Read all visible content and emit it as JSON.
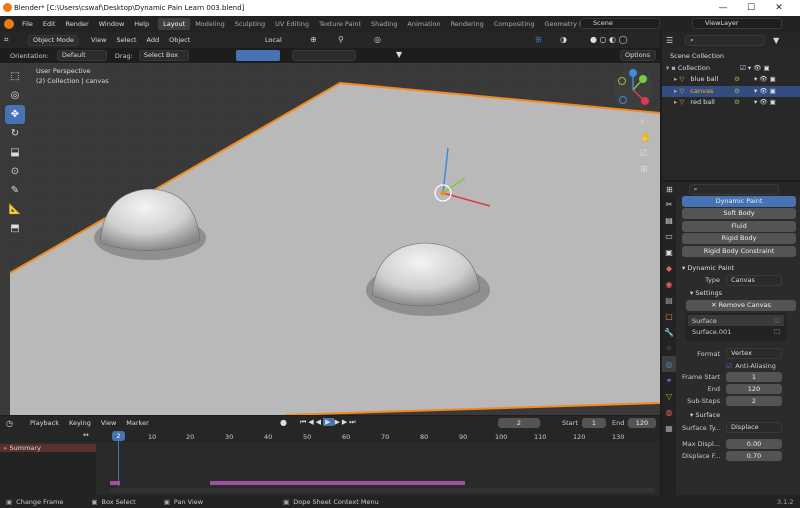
{
  "window": {
    "title": "Blender* [C:\\Users\\cswaf\\Desktop\\Dynamic Pain Learn 003.blend]",
    "minimize": "—",
    "maximize": "☐",
    "close": "✕"
  },
  "menubar": {
    "menus": [
      "File",
      "Edit",
      "Render",
      "Window",
      "Help"
    ],
    "workspaces": [
      "Layout",
      "Modeling",
      "Sculpting",
      "UV Editing",
      "Texture Paint",
      "Shading",
      "Animation",
      "Rendering",
      "Compositing",
      "Geometry Nodes"
    ],
    "active_workspace": "Layout",
    "scene": "Scene",
    "view_layer": "ViewLayer"
  },
  "viewport_header": {
    "mode": "Object Mode",
    "menus": [
      "View",
      "Select",
      "Add",
      "Object"
    ],
    "transform_orientation": "Local",
    "orientation_label": "Orientation:",
    "orientation_value": "Default",
    "drag_label": "Drag:",
    "drag_value": "Select Box",
    "options": "Options"
  },
  "viewport": {
    "view_name": "User Perspective",
    "collection_info": "(2) Collection | canvas",
    "background_color": "#393939",
    "plane_color": "#b9b9b9",
    "selection_color": "#f08a1e"
  },
  "toolbar": {
    "tools": [
      "select-box-icon",
      "cursor-icon",
      "move-icon",
      "rotate-icon",
      "scale-icon",
      "transform-icon",
      "annotate-icon",
      "measure-icon",
      "add-cube-icon"
    ],
    "active_tool": "move-icon"
  },
  "timeline": {
    "menus": [
      "Playback",
      "Keying",
      "View",
      "Marker"
    ],
    "current_frame": "2",
    "start_label": "Start",
    "start": "1",
    "end_label": "End",
    "end": "120",
    "ticks": [
      "2",
      "10",
      "20",
      "30",
      "40",
      "50",
      "60",
      "70",
      "80",
      "90",
      "100",
      "110",
      "120",
      "130"
    ],
    "summary_label": "Summary",
    "frame_indicator": "2"
  },
  "status": {
    "items": [
      "Change Frame",
      "Box Select",
      "Pan View",
      "Dope Sheet Context Menu"
    ],
    "version": "3.1.2"
  },
  "outliner": {
    "root": "Scene Collection",
    "collection": "Collection",
    "objects": [
      {
        "name": "blue ball",
        "selected": false
      },
      {
        "name": "canvas",
        "selected": true
      },
      {
        "name": "red ball",
        "selected": false
      }
    ]
  },
  "properties": {
    "search_placeholder": "",
    "physics_buttons": [
      "Dynamic Paint",
      "Soft Body",
      "Fluid",
      "Rigid Body",
      "Rigid Body Constraint"
    ],
    "dynamic_paint_panel": "Dynamic Paint",
    "type_label": "Type",
    "type_value": "Canvas",
    "settings_panel": "Settings",
    "remove_canvas": "Remove Canvas",
    "surfaces": [
      "Surface",
      "Surface.001"
    ],
    "format_label": "Format",
    "format_value": "Vertex",
    "anti_aliasing": "Anti-Aliasing",
    "frame_start_label": "Frame Start",
    "frame_start": "1",
    "end_label": "End",
    "end": "120",
    "substeps_label": "Sub-Steps",
    "substeps": "2",
    "surface_panel": "Surface",
    "surface_type_label": "Surface Ty...",
    "surface_type_value": "Displace",
    "max_displace_label": "Max Displ...",
    "max_displace": "0.00",
    "displace_factor_label": "Displace F...",
    "displace_factor": "0.70"
  }
}
